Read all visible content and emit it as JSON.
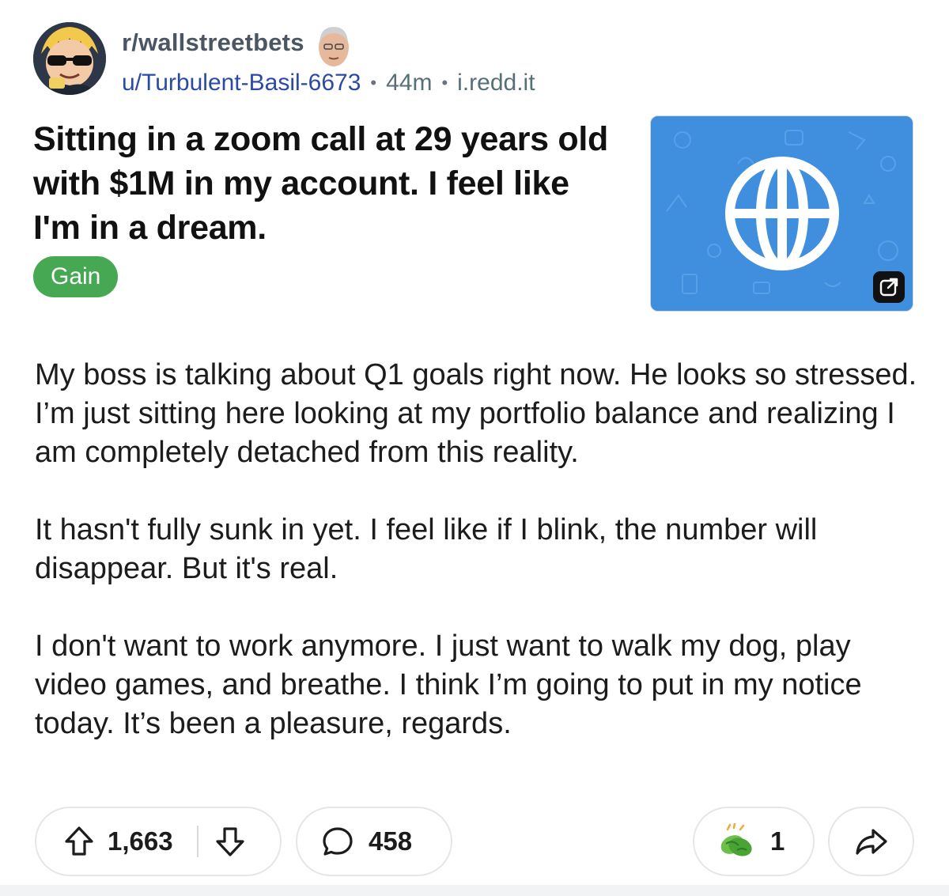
{
  "post": {
    "subreddit": "r/wallstreetbets",
    "author": "u/Turbulent-Basil-6673",
    "separator": "•",
    "age": "44m",
    "domain": "i.redd.it",
    "title": "Sitting in a zoom call at 29 years old with $1M in my account. I feel like I'm in a dream.",
    "flair": "Gain",
    "thumbnail_icon": "globe-icon",
    "body": [
      "My boss is talking about Q1 goals right now. He looks so stressed. I’m just sitting here looking at my portfolio balance and realizing I am completely detached from this reality.",
      "It hasn't fully sunk in yet. I feel like if I blink, the number will disappear. But it's real.",
      "I don't want to work anymore. I just want to walk my dog, play video games, and breathe. I think I’m going to put in my notice today. It’s been a pleasure, regards."
    ]
  },
  "actions": {
    "upvotes": "1,663",
    "comments": "458",
    "awards": "1"
  },
  "colors": {
    "flair_bg": "#46a853",
    "author_link": "#2b4aa8",
    "thumbnail_bg": "#3f8fde"
  }
}
